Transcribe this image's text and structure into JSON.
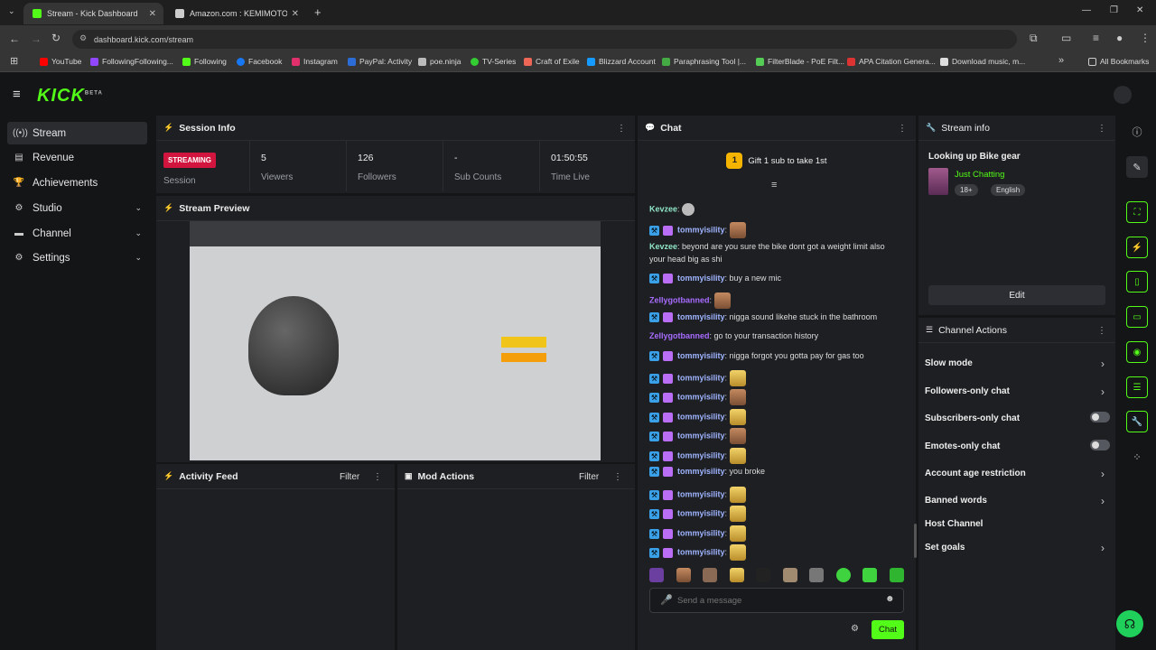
{
  "browser": {
    "tabs": [
      {
        "title": "Stream - Kick Dashboard"
      },
      {
        "title": "Amazon.com : KEMIMOTO Ful"
      }
    ],
    "url": "dashboard.kick.com/stream",
    "bookmarks": [
      "YouTube",
      "FollowingFollowing...",
      "Following",
      "Facebook",
      "Instagram",
      "PayPal: Activity",
      "poe.ninja",
      "TV-Series",
      "Craft of Exile",
      "Blizzard Account",
      "Paraphrasing Tool |...",
      "FilterBlade - PoE Filt...",
      "APA Citation Genera...",
      "Download music, m..."
    ],
    "all_bookmarks": "All Bookmarks"
  },
  "app": {
    "logo": "KICK",
    "logo_sup": "BETA"
  },
  "sidebar": {
    "items": [
      {
        "label": "Stream"
      },
      {
        "label": "Revenue"
      },
      {
        "label": "Achievements"
      },
      {
        "label": "Studio"
      },
      {
        "label": "Channel"
      },
      {
        "label": "Settings"
      }
    ]
  },
  "session": {
    "title": "Session Info",
    "status": "STREAMING",
    "status_label": "Session",
    "stats": [
      {
        "value": "5",
        "label": "Viewers"
      },
      {
        "value": "126",
        "label": "Followers"
      },
      {
        "value": "-",
        "label": "Sub Counts"
      },
      {
        "value": "01:50:55",
        "label": "Time Live"
      }
    ]
  },
  "preview": {
    "title": "Stream Preview"
  },
  "activity": {
    "title": "Activity Feed",
    "filter": "Filter"
  },
  "mod": {
    "title": "Mod Actions",
    "filter": "Filter"
  },
  "chat": {
    "title": "Chat",
    "gift_count": "1",
    "gift_text": "Gift 1 sub to take 1st",
    "messages": [
      {
        "user": "Kevzee",
        "type": "u3",
        "badges": false,
        "text": "",
        "emote": "grey"
      },
      {
        "user": "tommyisility",
        "type": "u1",
        "badges": true,
        "text": "",
        "emote": "face"
      },
      {
        "user": "Kevzee",
        "type": "u3",
        "badges": false,
        "text": "beyond are you sure the bike dont got a weight limit also",
        "emote": ""
      },
      {
        "user": "",
        "type": "cont",
        "badges": false,
        "text": "your head big as shi",
        "emote": ""
      },
      {
        "user": "tommyisility",
        "type": "u1",
        "badges": true,
        "text": "buy a new mic",
        "emote": ""
      },
      {
        "user": "Zellygotbanned",
        "type": "u2",
        "badges": false,
        "text": "",
        "emote": "face"
      },
      {
        "user": "tommyisility",
        "type": "u1",
        "badges": true,
        "text": "nigga sound likehe stuck in the bathroom",
        "emote": ""
      },
      {
        "user": "Zellygotbanned",
        "type": "u2",
        "badges": false,
        "text": "go to your transaction history",
        "emote": ""
      },
      {
        "user": "tommyisility",
        "type": "u1",
        "badges": true,
        "text": "nigga forgot you gotta pay for gas too",
        "emote": ""
      },
      {
        "user": "tommyisility",
        "type": "u1",
        "badges": true,
        "text": "",
        "emote": "gold"
      },
      {
        "user": "tommyisility",
        "type": "u1",
        "badges": true,
        "text": "",
        "emote": "face"
      },
      {
        "user": "tommyisility",
        "type": "u1",
        "badges": true,
        "text": "",
        "emote": "gold"
      },
      {
        "user": "tommyisility",
        "type": "u1",
        "badges": true,
        "text": "",
        "emote": "face"
      },
      {
        "user": "tommyisility",
        "type": "u1",
        "badges": true,
        "text": "",
        "emote": "gold"
      },
      {
        "user": "tommyisility",
        "type": "u1",
        "badges": true,
        "text": "you broke",
        "emote": ""
      },
      {
        "user": "tommyisility",
        "type": "u1",
        "badges": true,
        "text": "",
        "emote": "gold"
      },
      {
        "user": "tommyisility",
        "type": "u1",
        "badges": true,
        "text": "",
        "emote": "gold"
      },
      {
        "user": "tommyisility",
        "type": "u1",
        "badges": true,
        "text": "",
        "emote": "gold"
      },
      {
        "user": "tommyisility",
        "type": "u1",
        "badges": true,
        "text": "",
        "emote": "gold"
      }
    ],
    "input_placeholder": "Send a message",
    "send_label": "Chat"
  },
  "stream_info": {
    "title": "Stream info",
    "stream_title": "Looking up Bike gear",
    "category": "Just Chatting",
    "tags": [
      "18+",
      "English"
    ],
    "edit_label": "Edit"
  },
  "channel_actions": {
    "title": "Channel Actions",
    "items": [
      {
        "label": "Slow mode",
        "kind": "chevron"
      },
      {
        "label": "Followers-only chat",
        "kind": "chevron"
      },
      {
        "label": "Subscribers-only chat",
        "kind": "toggle"
      },
      {
        "label": "Emotes-only chat",
        "kind": "toggle"
      },
      {
        "label": "Account age restriction",
        "kind": "chevron"
      },
      {
        "label": "Banned words",
        "kind": "chevron"
      },
      {
        "label": "Host Channel",
        "kind": "none"
      },
      {
        "label": "Set goals",
        "kind": "chevron"
      }
    ]
  },
  "colors": {
    "accent": "#53fc18",
    "live": "#d1153e",
    "panel": "#1d1f22",
    "bg": "#141517"
  }
}
